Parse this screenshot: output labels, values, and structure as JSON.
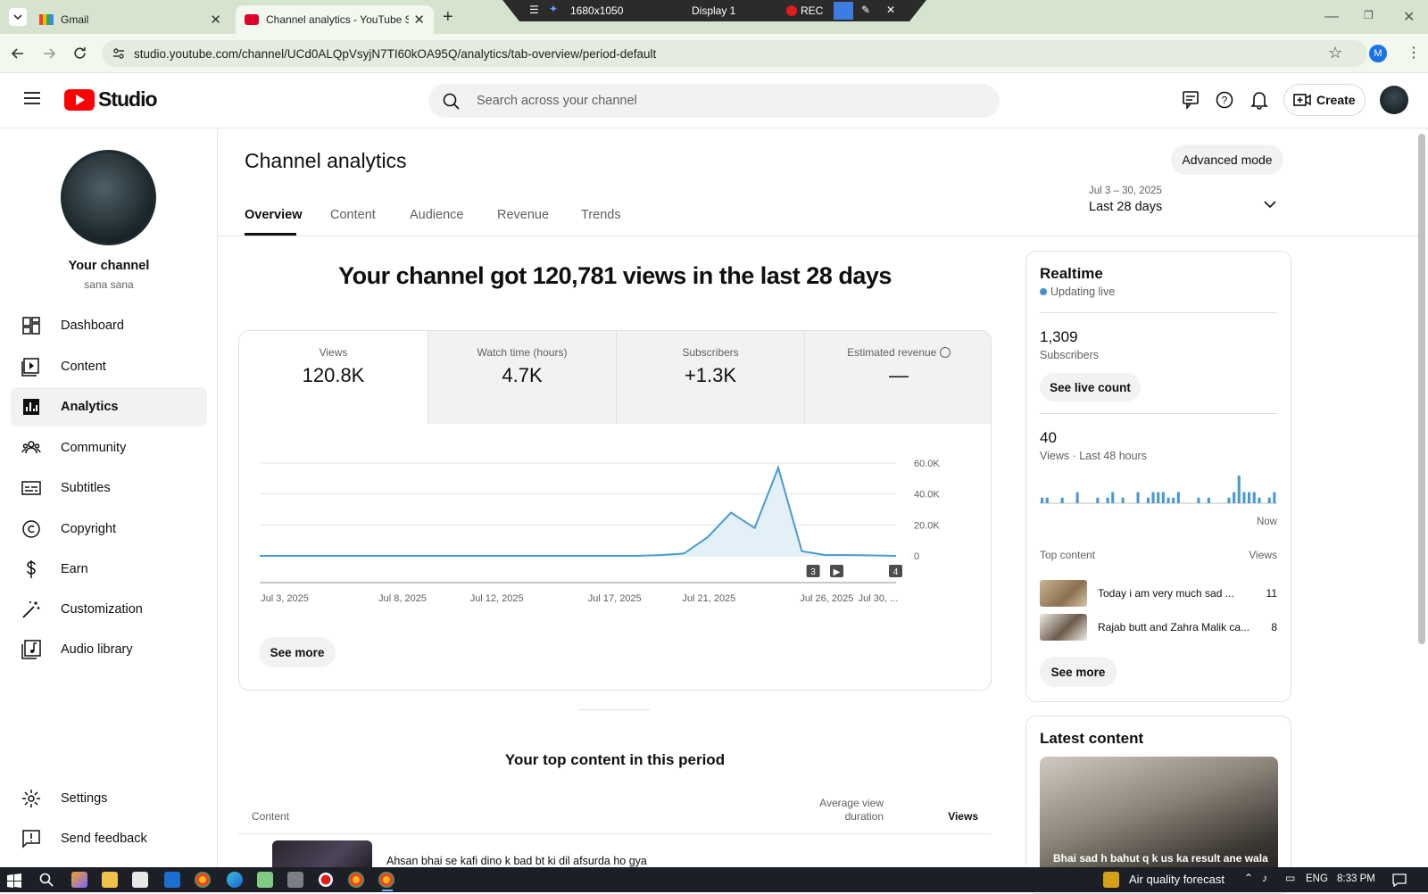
{
  "browser": {
    "tabs": [
      {
        "label": "Gmail"
      },
      {
        "label": "Channel analytics - YouTube St"
      }
    ],
    "recorder": {
      "resolution": "1680x1050",
      "display": "Display 1",
      "rec": "REC"
    },
    "url": "studio.youtube.com/channel/UCd0ALQpVsyjN7TI60kOA95Q/analytics/tab-overview/period-default",
    "profile_initial": "M"
  },
  "header": {
    "logo_text": "Studio",
    "search_placeholder": "Search across your channel",
    "create_label": "Create"
  },
  "sidebar": {
    "channel_title": "Your channel",
    "channel_handle": "sana sana",
    "items": [
      {
        "label": "Dashboard",
        "icon": "dashboard-icon"
      },
      {
        "label": "Content",
        "icon": "content-icon"
      },
      {
        "label": "Analytics",
        "icon": "analytics-icon",
        "active": true
      },
      {
        "label": "Community",
        "icon": "community-icon"
      },
      {
        "label": "Subtitles",
        "icon": "subtitles-icon"
      },
      {
        "label": "Copyright",
        "icon": "copyright-icon"
      },
      {
        "label": "Earn",
        "icon": "earn-icon"
      },
      {
        "label": "Customization",
        "icon": "customization-icon"
      },
      {
        "label": "Audio library",
        "icon": "audio-library-icon"
      }
    ],
    "bottom": [
      {
        "label": "Settings",
        "icon": "settings-icon"
      },
      {
        "label": "Send feedback",
        "icon": "feedback-icon"
      }
    ]
  },
  "main": {
    "title": "Channel analytics",
    "advanced_mode": "Advanced mode",
    "tabs": [
      "Overview",
      "Content",
      "Audience",
      "Revenue",
      "Trends"
    ],
    "date_range": "Jul 3 – 30, 2025",
    "period": "Last 28 days",
    "headline": "Your channel got 120,781 views in the last 28 days",
    "metrics": [
      {
        "label": "Views",
        "value": "120.8K"
      },
      {
        "label": "Watch time (hours)",
        "value": "4.7K"
      },
      {
        "label": "Subscribers",
        "value": "+1.3K"
      },
      {
        "label": "Estimated revenue",
        "value": "—"
      }
    ],
    "see_more": "See more",
    "top_content_title": "Your top content in this period",
    "table_headers": {
      "content": "Content",
      "avg_duration_1": "Average view",
      "avg_duration_2": "duration",
      "views": "Views"
    },
    "top_row_title": "Ahsan bhai se kafi dino k bad bt ki dil afsurda ho gya"
  },
  "chart_data": {
    "type": "line",
    "x_tick_labels": [
      "Jul 3, 2025",
      "Jul 8, 2025",
      "Jul 12, 2025",
      "Jul 17, 2025",
      "Jul 21, 2025",
      "Jul 26, 2025",
      "Jul 30, ..."
    ],
    "y_tick_labels": [
      "60.0K",
      "40.0K",
      "20.0K",
      "0"
    ],
    "ylim": [
      0,
      60000
    ],
    "series": [
      {
        "values": [
          0,
          0,
          0,
          0,
          0,
          0,
          0,
          0,
          0,
          0,
          0,
          0,
          0,
          0,
          0,
          0,
          0,
          500,
          1500,
          12000,
          28000,
          18000,
          57000,
          3000,
          500,
          500,
          300,
          0
        ]
      }
    ],
    "markers": [
      "3",
      "▶",
      "4"
    ]
  },
  "realtime": {
    "title": "Realtime",
    "status": "Updating live",
    "subscribers_value": "1,309",
    "subscribers_label": "Subscribers",
    "see_live": "See live count",
    "views_value": "40",
    "views_label": "Views · Last 48 hours",
    "now_label": "Now",
    "bars": [
      1,
      1,
      0,
      0,
      1,
      0,
      0,
      2,
      0,
      0,
      0,
      1,
      0,
      1,
      2,
      0,
      1,
      0,
      0,
      2,
      0,
      1,
      2,
      2,
      2,
      1,
      1,
      2,
      0,
      0,
      0,
      1,
      0,
      1,
      0,
      0,
      0,
      1,
      2,
      5,
      2,
      2,
      2,
      1,
      0,
      1,
      2
    ],
    "top_content_label": "Top content",
    "views_header": "Views",
    "items": [
      {
        "title": "Today i am very much sad ...",
        "views": "11"
      },
      {
        "title": "Rajab butt and Zahra Malik ca...",
        "views": "8"
      }
    ],
    "see_more": "See more"
  },
  "latest": {
    "title": "Latest content",
    "video_caption": "Bhai sad h bahut q k us ka result ane wala"
  },
  "taskbar": {
    "weather": "Air quality forecast",
    "lang": "ENG",
    "time": "8:33 PM"
  }
}
